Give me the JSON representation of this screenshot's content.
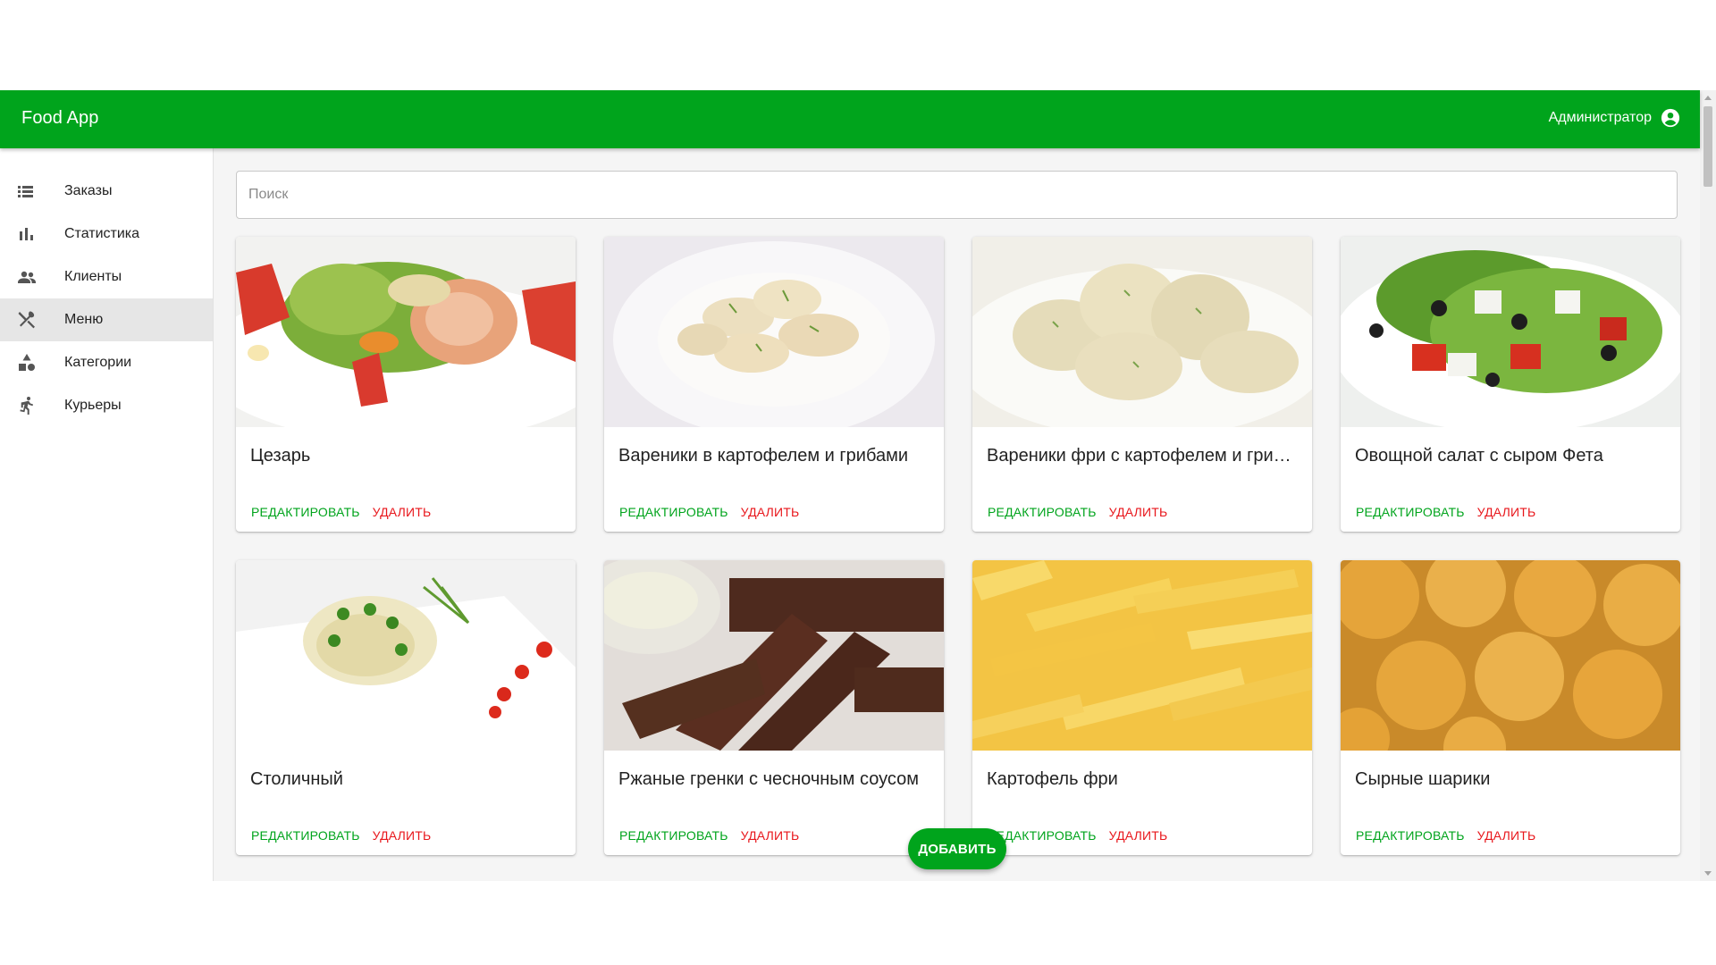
{
  "app": {
    "title": "Food App",
    "user_name": "Администратор",
    "brand_color": "#00a41c",
    "danger_color": "#e8161b"
  },
  "sidebar": {
    "items": [
      {
        "label": "Заказы",
        "icon": "list-icon",
        "active": false
      },
      {
        "label": "Статистика",
        "icon": "bar-chart-icon",
        "active": false
      },
      {
        "label": "Клиенты",
        "icon": "people-icon",
        "active": false
      },
      {
        "label": "Меню",
        "icon": "utensils-icon",
        "active": true
      },
      {
        "label": "Категории",
        "icon": "category-shapes-icon",
        "active": false
      },
      {
        "label": "Курьеры",
        "icon": "running-person-icon",
        "active": false
      }
    ]
  },
  "search": {
    "placeholder": "Поиск",
    "value": ""
  },
  "menu_items": [
    {
      "name": "Цезарь",
      "edit_label": "РЕДАКТИРОВАТЬ",
      "delete_label": "УДАЛИТЬ",
      "image": "caesar-salad"
    },
    {
      "name": "Вареники в картофелем и грибами",
      "edit_label": "РЕДАКТИРОВАТЬ",
      "delete_label": "УДАЛИТЬ",
      "image": "vareniki-plate"
    },
    {
      "name": "Вареники фри с картофелем и грибами",
      "edit_label": "РЕДАКТИРОВАТЬ",
      "delete_label": "УДАЛИТЬ",
      "image": "fried-vareniki"
    },
    {
      "name": "Овощной салат с сыром Фета",
      "edit_label": "РЕДАКТИРОВАТЬ",
      "delete_label": "УДАЛИТЬ",
      "image": "greek-salad"
    },
    {
      "name": "Столичный",
      "edit_label": "РЕДАКТИРОВАТЬ",
      "delete_label": "УДАЛИТЬ",
      "image": "stolichny-salad"
    },
    {
      "name": "Ржаные гренки с чесночным соусом",
      "edit_label": "РЕДАКТИРОВАТЬ",
      "delete_label": "УДАЛИТЬ",
      "image": "rye-croutons"
    },
    {
      "name": "Картофель фри",
      "edit_label": "РЕДАКТИРОВАТЬ",
      "delete_label": "УДАЛИТЬ",
      "image": "french-fries"
    },
    {
      "name": "Сырные шарики",
      "edit_label": "РЕДАКТИРОВАТЬ",
      "delete_label": "УДАЛИТЬ",
      "image": "cheese-balls"
    }
  ],
  "fab": {
    "label": "ДОБАВИТЬ"
  }
}
